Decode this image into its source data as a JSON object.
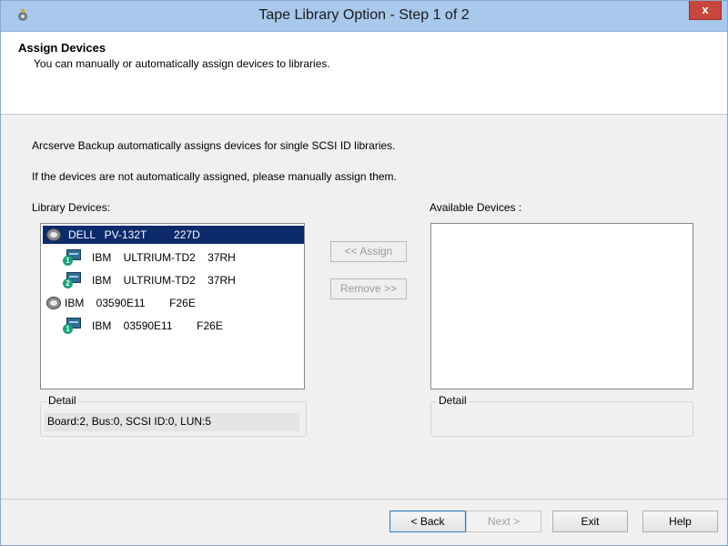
{
  "window": {
    "title": "Tape Library Option - Step 1 of 2",
    "close_label": "x"
  },
  "header": {
    "title": "Assign Devices",
    "subtitle": "You can manually or automatically assign devices to libraries."
  },
  "info": {
    "line1": "Arcserve Backup automatically assigns devices for single SCSI ID libraries.",
    "line2": "If the devices are not automatically assigned, please manually assign them."
  },
  "library_devices": {
    "label": "Library Devices:",
    "items": [
      {
        "label": "DELL   PV-132T         227D",
        "icon": "library-icon",
        "selected": true
      },
      {
        "label": "IBM    ULTRIUM-TD2    37RH",
        "icon": "tape-drive-icon",
        "badge": "1"
      },
      {
        "label": "IBM    ULTRIUM-TD2    37RH",
        "icon": "tape-drive-icon",
        "badge": "2"
      },
      {
        "label": "IBM    03590E11        F26E",
        "icon": "library-icon"
      },
      {
        "label": "IBM    03590E11        F26E",
        "icon": "tape-drive-icon",
        "badge": "1"
      }
    ],
    "detail_legend": "Detail",
    "detail_value": "Board:2, Bus:0, SCSI ID:0, LUN:5"
  },
  "available_devices": {
    "label": "Available Devices :",
    "detail_legend": "Detail"
  },
  "actions": {
    "assign": "<< Assign",
    "remove": "Remove >>"
  },
  "footer": {
    "back": "< Back",
    "next": "Next >",
    "exit": "Exit",
    "help": "Help"
  }
}
